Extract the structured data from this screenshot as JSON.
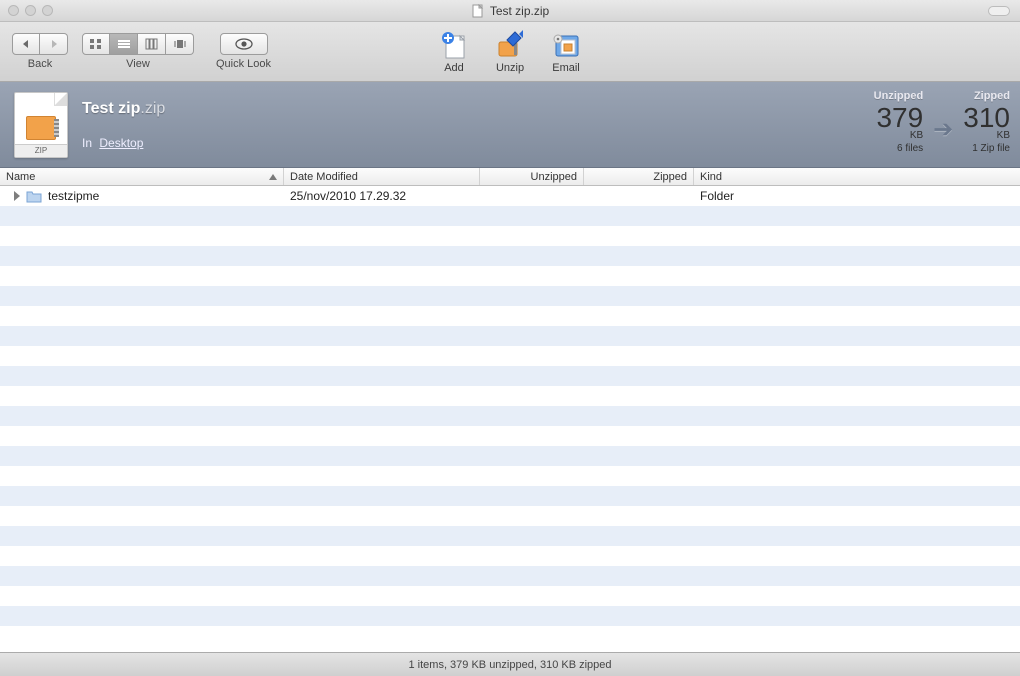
{
  "window": {
    "title": "Test zip.zip"
  },
  "toolbar": {
    "back_label": "Back",
    "view_label": "View",
    "quicklook_label": "Quick Look",
    "actions": {
      "add": "Add",
      "unzip": "Unzip",
      "email": "Email"
    }
  },
  "info": {
    "filename": "Test zip",
    "ext": ".zip",
    "location_prefix": "In",
    "location": "Desktop",
    "zip_badge": "ZIP",
    "stats": {
      "unzipped_label": "Unzipped",
      "unzipped_value": "379",
      "unzipped_unit": "KB",
      "unzipped_sub": "6 files",
      "zipped_label": "Zipped",
      "zipped_value": "310",
      "zipped_unit": "KB",
      "zipped_sub": "1 Zip file"
    }
  },
  "columns": {
    "name": "Name",
    "date": "Date Modified",
    "unzipped": "Unzipped",
    "zipped": "Zipped",
    "kind": "Kind"
  },
  "rows": [
    {
      "name": "testzipme",
      "date": "25/nov/2010 17.29.32",
      "unzipped": "",
      "zipped": "",
      "kind": "Folder"
    }
  ],
  "statusbar": "1 items, 379 KB unzipped, 310 KB zipped"
}
